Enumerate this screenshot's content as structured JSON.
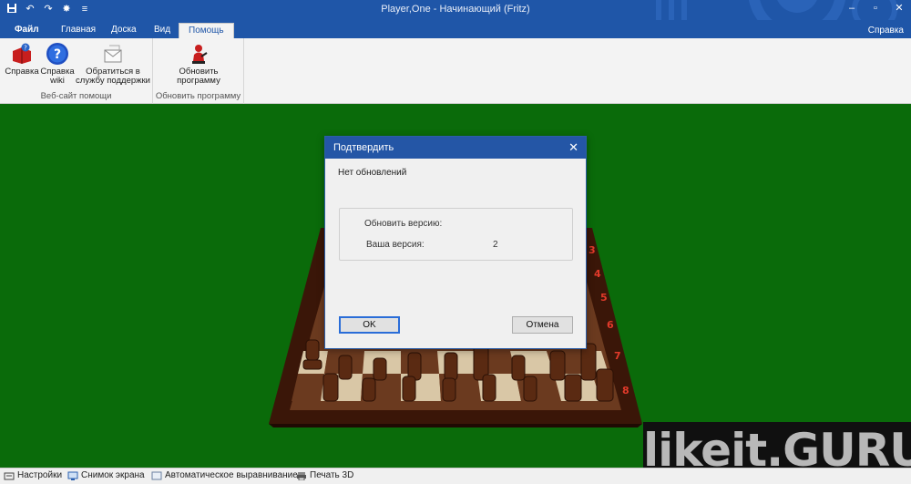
{
  "window": {
    "title": "Player,One  - Начинающий (Fritz)",
    "qat_icons": [
      "save-icon",
      "undo-icon",
      "redo-icon",
      "bug-icon",
      "customize-icon"
    ],
    "controls": {
      "minimize": "–",
      "restore": "▫",
      "close": "✕"
    }
  },
  "tabs": [
    {
      "label": "Файл"
    },
    {
      "label": "Главная"
    },
    {
      "label": "Доска"
    },
    {
      "label": "Вид"
    },
    {
      "label": "Помощь"
    }
  ],
  "help_link": "Справка",
  "ribbon": {
    "groups": [
      {
        "label": "Веб-сайт помощи",
        "buttons": [
          {
            "label": "Справка",
            "icon": "help-book-icon"
          },
          {
            "label": "Справка wiki",
            "icon": "help-question-icon"
          },
          {
            "label": "Обратиться в службу поддержки",
            "icon": "support-mail-icon"
          }
        ]
      },
      {
        "label": "Обновить программу",
        "buttons": [
          {
            "label": "Обновить программу",
            "icon": "update-icon"
          }
        ]
      }
    ]
  },
  "dialog": {
    "title": "Подтвердить",
    "message": "Нет обновлений",
    "update_version_label": "Обновить версию:",
    "your_version_label": "Ваша версия:",
    "your_version_value": "2",
    "ok_label": "OK",
    "cancel_label": "Отмена"
  },
  "board": {
    "rank_labels": [
      "3",
      "4",
      "5",
      "6",
      "7",
      "8"
    ]
  },
  "watermark": "likeit.GURU",
  "statusbar": [
    {
      "label": "Настройки",
      "icon": "settings-icon"
    },
    {
      "label": "Снимок экрана",
      "icon": "screenshot-icon"
    },
    {
      "label": "Автоматическое выравнивание",
      "icon": "auto-align-icon"
    },
    {
      "label": "Печать 3D",
      "icon": "print-3d-icon"
    }
  ],
  "colors": {
    "accent": "#1f56a8",
    "board_background": "#0a6b0a",
    "dialog_title": "#2456a6"
  }
}
